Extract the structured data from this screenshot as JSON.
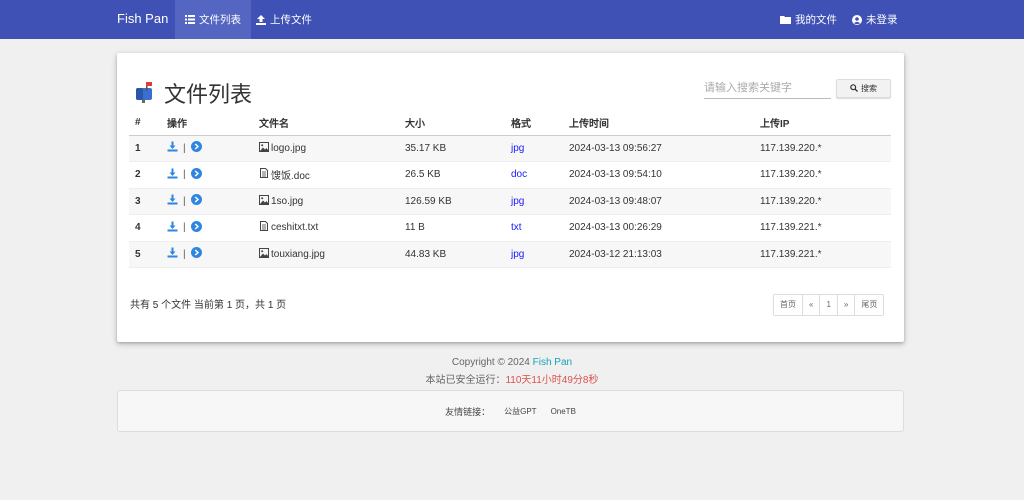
{
  "navbar": {
    "brand": "Fish Pan",
    "items": [
      {
        "label": "文件列表",
        "icon": "list-icon",
        "active": true
      },
      {
        "label": "上传文件",
        "icon": "upload-icon",
        "active": false
      }
    ],
    "right_items": [
      {
        "label": "我的文件",
        "icon": "folder-icon"
      },
      {
        "label": "未登录",
        "icon": "user-icon"
      }
    ]
  },
  "main": {
    "title": "文件列表",
    "search": {
      "placeholder": "请输入搜索关键字",
      "value": "",
      "button_label": "搜索"
    },
    "table": {
      "headers": [
        "#",
        "操作",
        "文件名",
        "大小",
        "格式",
        "上传时间",
        "上传IP"
      ],
      "rows": [
        {
          "index": "1",
          "filename": "logo.jpg",
          "size": "35.17 KB",
          "format": "jpg",
          "time": "2024-03-13 09:56:27",
          "ip": "117.139.220.*"
        },
        {
          "index": "2",
          "filename": "馊饭.doc",
          "size": "26.5 KB",
          "format": "doc",
          "time": "2024-03-13 09:54:10",
          "ip": "117.139.220.*"
        },
        {
          "index": "3",
          "filename": "1so.jpg",
          "size": "126.59 KB",
          "format": "jpg",
          "time": "2024-03-13 09:48:07",
          "ip": "117.139.220.*"
        },
        {
          "index": "4",
          "filename": "ceshitxt.txt",
          "size": "11 B",
          "format": "txt",
          "time": "2024-03-13 00:26:29",
          "ip": "117.139.221.*"
        },
        {
          "index": "5",
          "filename": "touxiang.jpg",
          "size": "44.83 KB",
          "format": "jpg",
          "time": "2024-03-12 21:13:03",
          "ip": "117.139.221.*"
        }
      ]
    },
    "summary": {
      "prefix": "共有",
      "count": "5",
      "mid": "个文件 当前第",
      "page": "1",
      "mid2": "页，共",
      "pages": "1",
      "suffix": "页"
    },
    "pagination": {
      "first": "首页",
      "prev": "«",
      "current": "1",
      "next": "»",
      "last": "尾页"
    }
  },
  "footer": {
    "copyright_prefix": "Copyright © 2024",
    "copyright_brand": "Fish Pan",
    "uptime_label": "本站已安全运行：",
    "uptime_value": "110天11小时49分8秒",
    "links_label": "友情链接：",
    "links": [
      "公益GPT",
      "OneTB"
    ]
  },
  "colors": {
    "navbar": "#3f51b5",
    "accent": "#17a2b8",
    "format_link": "#1a1aff",
    "uptime": "#d9534f",
    "action_icon": "#2f86e0"
  }
}
